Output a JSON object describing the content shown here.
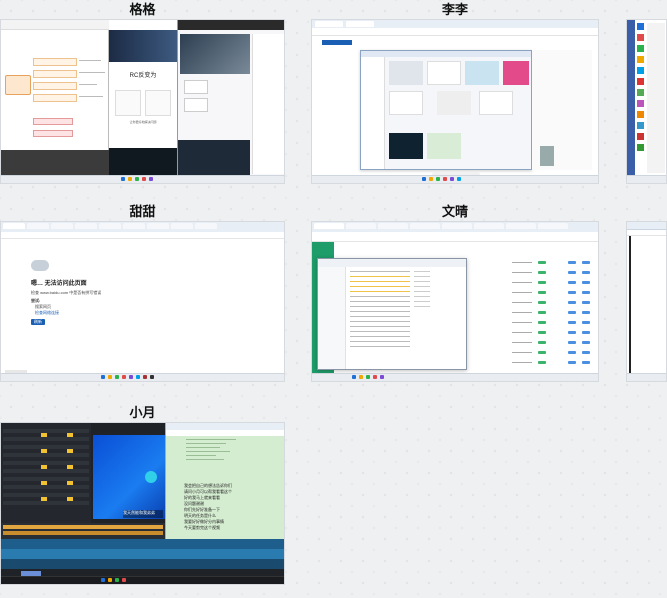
{
  "tiles": [
    {
      "name": "格格",
      "screen_type": "mindmap-and-product-page"
    },
    {
      "name": "李李",
      "screen_type": "file-window-with-thumbnails"
    },
    {
      "name": "",
      "screen_type": "desktop-icons-partial"
    },
    {
      "name": "甜甜",
      "screen_type": "browser-error-page"
    },
    {
      "name": "文晴",
      "screen_type": "file-explorer-and-spreadsheet"
    },
    {
      "name": "",
      "screen_type": "browser-partial"
    },
    {
      "name": "小月",
      "screen_type": "video-editor-and-chat"
    }
  ],
  "t1": {
    "page_heading": "RC反变为",
    "feature_caption": "让你更好地解决问题"
  },
  "t4": {
    "error_title": "嗯… 无法访问此页面",
    "error_line": "检查 www.baidu.com 中是否有拼写错误",
    "try_label": "尝试:",
    "try_items": [
      "搜索网页",
      "检查网络连接"
    ],
    "refresh_button": "刷新"
  },
  "t7": {
    "video_subtitle": "我天然能和我弟弟",
    "chat_lines": [
      "我会把自己的想法告诉你们",
      "请问小月可以帮我看看这个",
      "好的我马上就来看看",
      "没问题谢谢",
      "你们先好好准备一下",
      "明天的任务是什么",
      "我要好好做好分内事情",
      "今天要剪完这个视频"
    ]
  },
  "colors": {
    "accent": "#1a5fb4",
    "excel_green": "#1e9c6a",
    "editor_dark": "#1f2227",
    "chat_bg": "#d4ecd0"
  }
}
